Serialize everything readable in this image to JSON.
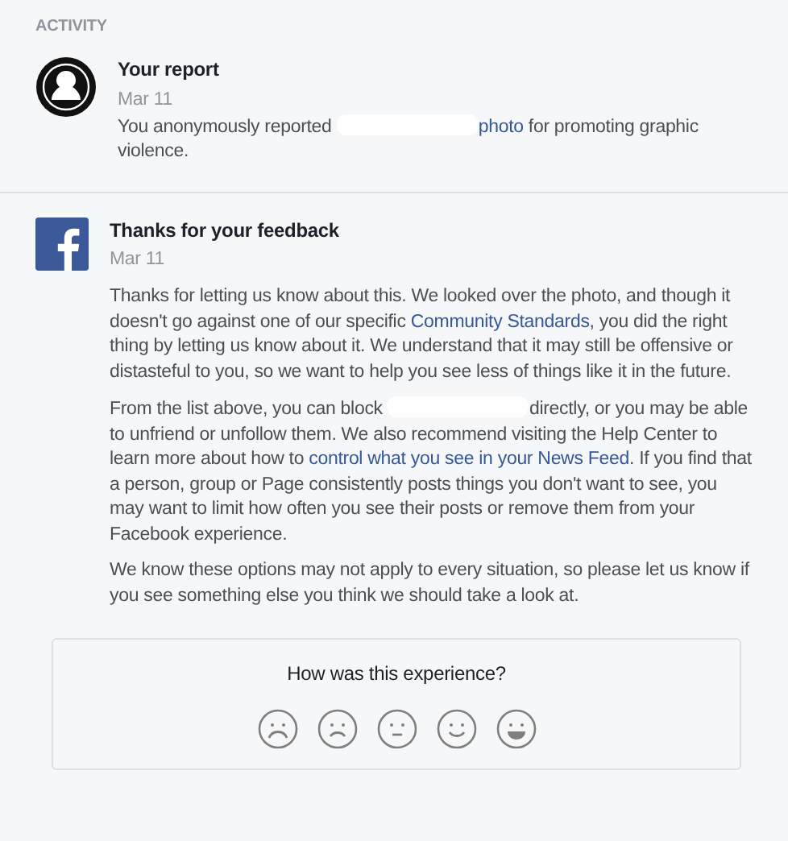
{
  "section_label": "ACTIVITY",
  "items": [
    {
      "kind": "report",
      "title": "Your report",
      "date": "Mar 11",
      "paragraphs": [
        [
          {
            "kind": "text",
            "text": "You anonymously reported "
          },
          {
            "kind": "redacted"
          },
          {
            "kind": "link",
            "text": "photo"
          },
          {
            "kind": "text",
            "text": " for promoting graphic violence."
          }
        ]
      ]
    },
    {
      "kind": "feedback",
      "title": "Thanks for your feedback",
      "date": "Mar 11",
      "paragraphs": [
        [
          {
            "kind": "text",
            "text": "Thanks for letting us know about this. We looked over the photo, and though it doesn't go against one of our specific "
          },
          {
            "kind": "link",
            "text": "Community Standards"
          },
          {
            "kind": "text",
            "text": ", you did the right thing by letting us know about it. We understand that it may still be offensive or distasteful to you, so we want to help you see less of things like it in the future."
          }
        ],
        [
          {
            "kind": "text",
            "text": "From the list above, you can block "
          },
          {
            "kind": "redacted"
          },
          {
            "kind": "text",
            "text": "directly, or you may be able to unfriend or unfollow them. We also recommend visiting the Help Center to learn more about how to "
          },
          {
            "kind": "link",
            "text": "control what you see in your News Feed"
          },
          {
            "kind": "text",
            "text": ". If you find that a person, group or Page consistently posts things you don't want to see, you may want to limit how often you see their posts or remove them from your Facebook experience."
          }
        ],
        [
          {
            "kind": "text",
            "text": "We know these options may not apply to every situation, so please let us know if you see something else you think we should take a look at."
          }
        ]
      ]
    }
  ],
  "rating": {
    "question": "How was this experience?",
    "faces": [
      {
        "kind": "very-sad"
      },
      {
        "kind": "sad"
      },
      {
        "kind": "neutral"
      },
      {
        "kind": "happy"
      },
      {
        "kind": "very-happy"
      }
    ]
  }
}
